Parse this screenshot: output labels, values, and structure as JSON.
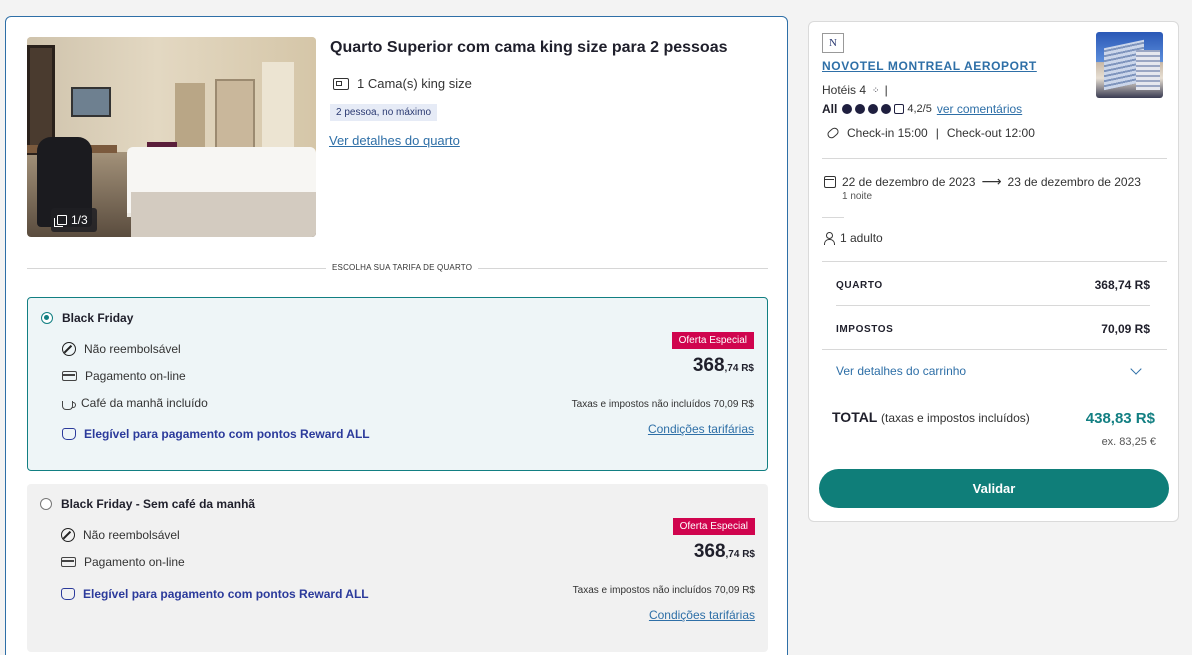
{
  "room": {
    "photo_counter": "1/3",
    "title": "Quarto Superior com cama king size para 2 pessoas",
    "beds": "1 Cama(s) king size",
    "max_people": "2 pessoa, no máximo",
    "details_link": "Ver detalhes do quarto",
    "rate_section_label": "ESCOLHA SUA TARIFA DE QUARTO"
  },
  "rates": [
    {
      "name": "Black Friday",
      "selected": true,
      "features": [
        "Não reembolsável",
        "Pagamento on-line",
        "Café da manhã incluído"
      ],
      "reward": "Elegível para pagamento com pontos Reward ALL",
      "promo": "Oferta Especial",
      "price_main": "368",
      "price_decimals": ",74 R$",
      "taxes": "Taxas e impostos não incluídos 70,09 R$",
      "conditions": "Condições tarifárias"
    },
    {
      "name": "Black Friday - Sem café da manhã",
      "selected": false,
      "features": [
        "Não reembolsável",
        "Pagamento on-line"
      ],
      "reward": "Elegível para pagamento com pontos Reward ALL",
      "promo": "Oferta Especial",
      "price_main": "368",
      "price_decimals": ",74 R$",
      "taxes": "Taxas e impostos não incluídos 70,09 R$",
      "conditions": "Condições tarifárias"
    }
  ],
  "summary": {
    "logo_letter": "N",
    "hotel_name": "NOVOTEL MONTREAL AEROPORT",
    "hotel_class": "Hotéis 4",
    "separator": "|",
    "rating_brand": "All",
    "rating_value": "4,2/5",
    "rating_dots_filled": 4,
    "rating_dots_total": 5,
    "reviews_link": "ver comentários",
    "checkin": "Check-in 15:00",
    "checkout": "Check-out 12:00",
    "date_from": "22 de dezembro de 2023",
    "date_to": "23 de dezembro de 2023",
    "nights": "1 noite",
    "guests": "1 adulto",
    "room_label": "QUARTO",
    "room_value": "368,74 R$",
    "tax_label": "IMPOSTOS",
    "tax_value": "70,09 R$",
    "cart_link": "Ver detalhes do carrinho",
    "total_label": "TOTAL",
    "total_note": "(taxas e impostos incluídos)",
    "total_value": "438,83 R$",
    "total_ex": "ex. 83,25 €",
    "validate_button": "Validar"
  },
  "colors": {
    "teal": "#0f7e79",
    "link": "#2e6fa7",
    "promo": "#d0044e",
    "reward": "#2b3a9b"
  }
}
